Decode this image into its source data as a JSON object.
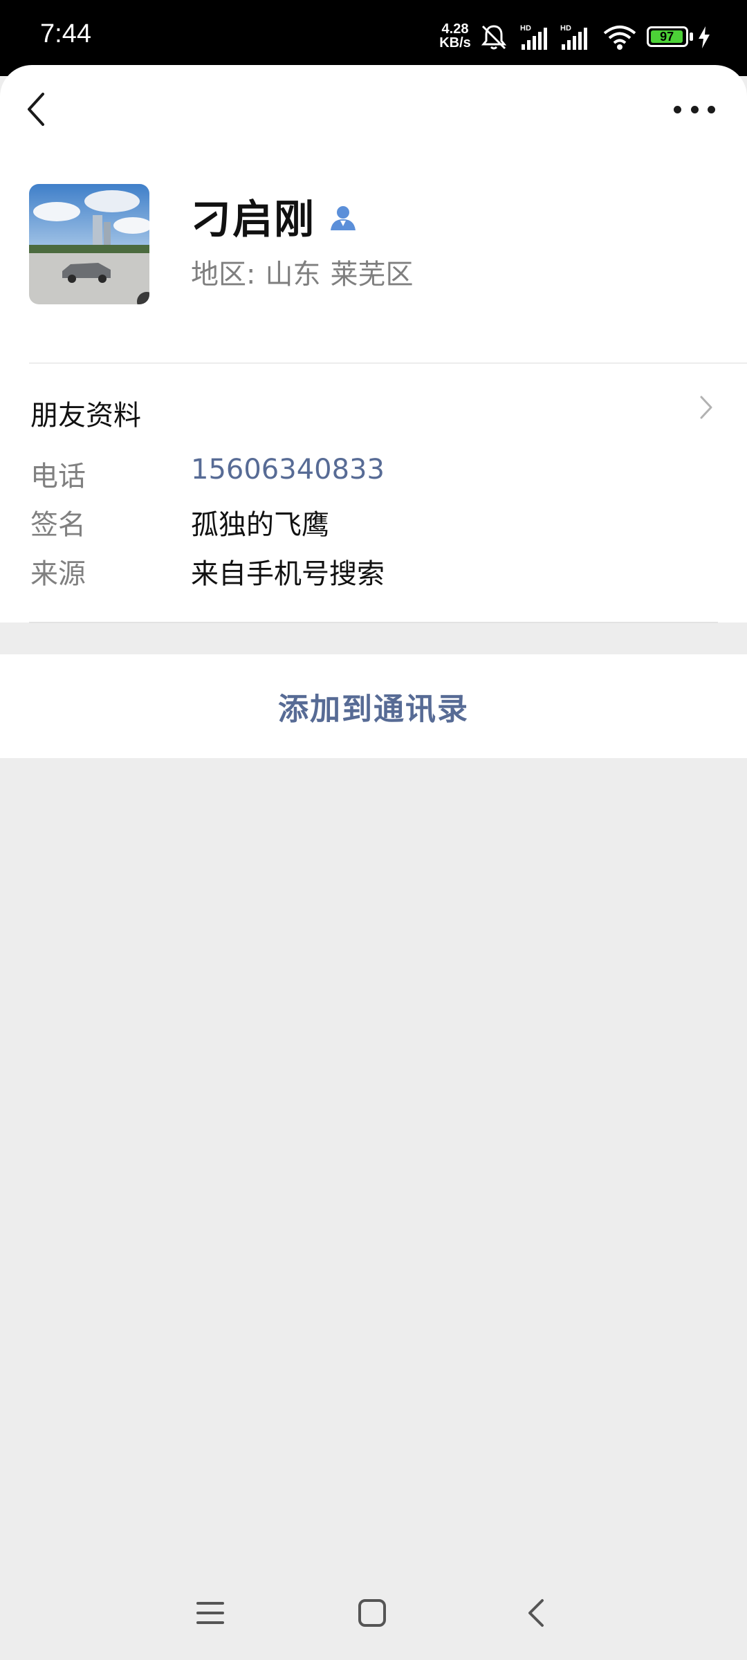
{
  "status_bar": {
    "time": "7:44",
    "net_speed_value": "4.28",
    "net_speed_unit": "KB/s",
    "signal_1_label": "HD",
    "signal_2_label": "HD",
    "battery_level": "97"
  },
  "header": {
    "back_icon": "chevron-left-icon",
    "more_icon": "more-dots-icon"
  },
  "profile": {
    "name": "刁启刚",
    "region_label": "地区:",
    "region_province": "山东",
    "region_city": "莱芜区"
  },
  "friend_info": {
    "section_title": "朋友资料",
    "phone_label": "电话",
    "phone_value": "15606340833",
    "signature_label": "签名",
    "signature_value": "孤独的飞鹰",
    "source_label": "来源",
    "source_value": "来自手机号搜索"
  },
  "actions": {
    "add_to_contacts": "添加到通讯录"
  },
  "colors": {
    "link": "#576b95",
    "background": "#ededed",
    "battery": "#4cd137"
  }
}
